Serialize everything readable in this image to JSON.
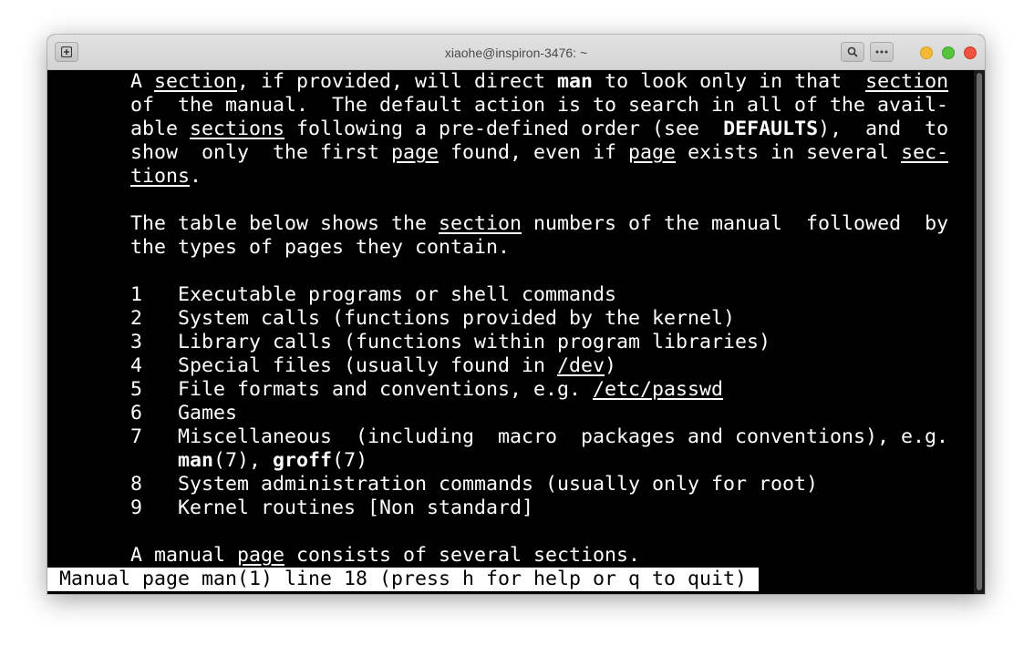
{
  "window": {
    "title": "xiaohe@inspiron-3476: ~"
  },
  "titlebar": {
    "new_tab_icon": "new-tab-icon",
    "search_icon": "search-icon",
    "menu_icon": "menu-dots-icon",
    "minimize_color": "#f6b937",
    "maximize_color": "#55c43b",
    "close_color": "#f0523f"
  },
  "terminal": {
    "background": "#000000",
    "foreground": "#ffffff",
    "lines": [
      [
        {
          "t": "       A "
        },
        {
          "t": "section",
          "u": true
        },
        {
          "t": ", if provided, will direct "
        },
        {
          "t": "man",
          "b": true
        },
        {
          "t": " to look only in that  "
        },
        {
          "t": "section",
          "u": true
        }
      ],
      [
        {
          "t": "       of  the manual.  The default action is to search in all of the avail-"
        }
      ],
      [
        {
          "t": "       able "
        },
        {
          "t": "sections",
          "u": true
        },
        {
          "t": " following a pre-defined order (see  "
        },
        {
          "t": "DEFAULTS",
          "b": true
        },
        {
          "t": "),  and  to"
        }
      ],
      [
        {
          "t": "       show  only  the first "
        },
        {
          "t": "page",
          "u": true
        },
        {
          "t": " found, even if "
        },
        {
          "t": "page",
          "u": true
        },
        {
          "t": " exists in several "
        },
        {
          "t": "sec-",
          "u": true
        }
      ],
      [
        {
          "t": "       "
        },
        {
          "t": "tions",
          "u": true
        },
        {
          "t": "."
        }
      ],
      [
        {
          "t": ""
        }
      ],
      [
        {
          "t": "       The table below shows the "
        },
        {
          "t": "section",
          "u": true
        },
        {
          "t": " numbers of the manual  followed  by"
        }
      ],
      [
        {
          "t": "       the types of pages they contain."
        }
      ],
      [
        {
          "t": ""
        }
      ],
      [
        {
          "t": "       1   Executable programs or shell commands"
        }
      ],
      [
        {
          "t": "       2   System calls (functions provided by the kernel)"
        }
      ],
      [
        {
          "t": "       3   Library calls (functions within program libraries)"
        }
      ],
      [
        {
          "t": "       4   Special files (usually found in "
        },
        {
          "t": "/dev",
          "u": true
        },
        {
          "t": ")"
        }
      ],
      [
        {
          "t": "       5   File formats and conventions, e.g. "
        },
        {
          "t": "/etc/passwd",
          "u": true
        }
      ],
      [
        {
          "t": "       6   Games"
        }
      ],
      [
        {
          "t": "       7   Miscellaneous  (including  macro  packages and conventions), e.g."
        }
      ],
      [
        {
          "t": "           "
        },
        {
          "t": "man",
          "b": true
        },
        {
          "t": "(7), "
        },
        {
          "t": "groff",
          "b": true
        },
        {
          "t": "(7)"
        }
      ],
      [
        {
          "t": "       8   System administration commands (usually only for root)"
        }
      ],
      [
        {
          "t": "       9   Kernel routines [Non standard]"
        }
      ],
      [
        {
          "t": ""
        }
      ],
      [
        {
          "t": "       A manual "
        },
        {
          "t": "page",
          "u": true
        },
        {
          "t": " consists of several sections."
        }
      ]
    ],
    "status_line": "Manual page man(1) line 18 (press h for help or q to quit)"
  }
}
